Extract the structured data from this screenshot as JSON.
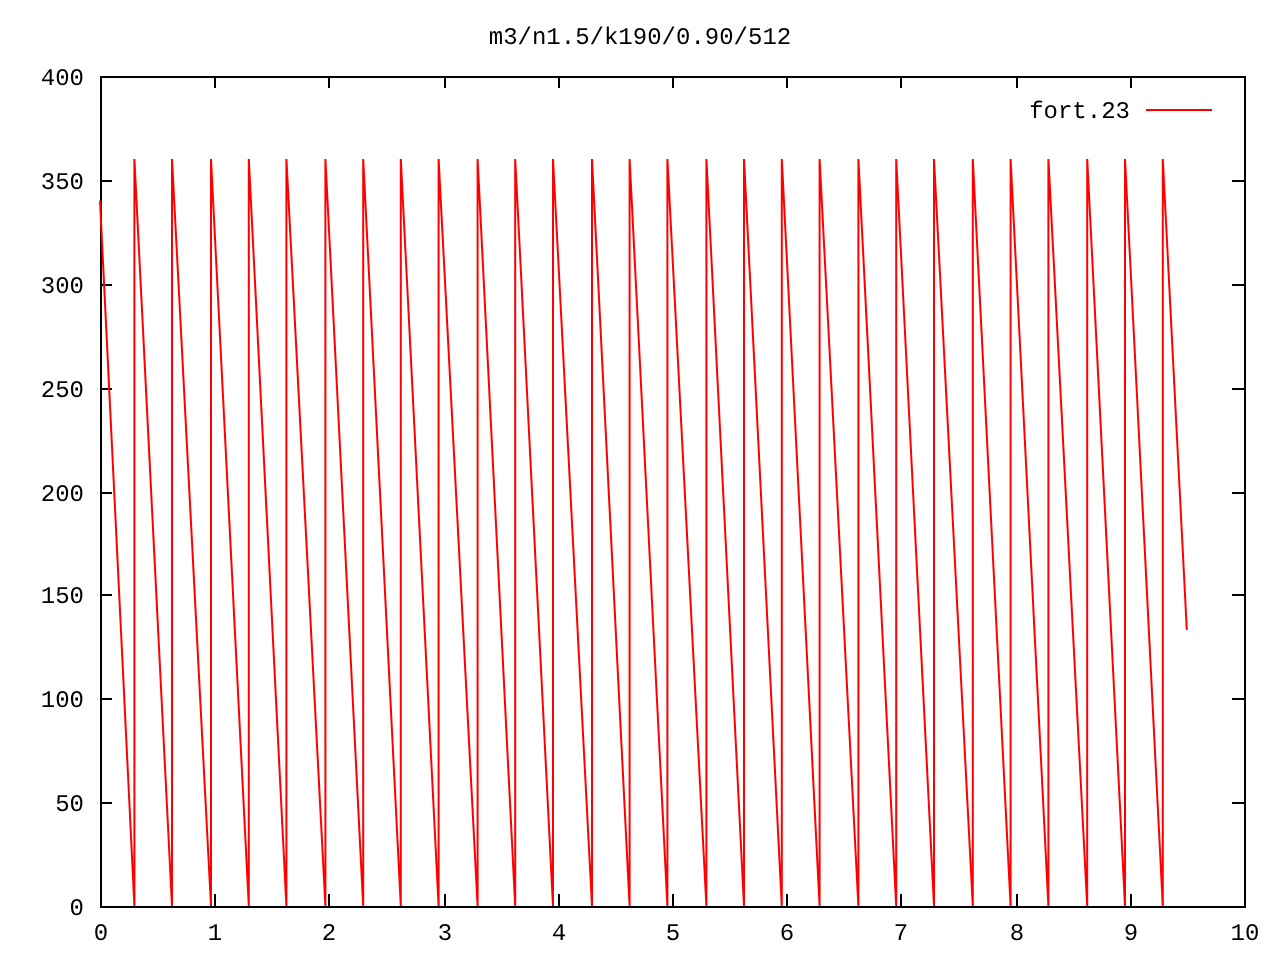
{
  "chart_data": {
    "type": "line",
    "title": "m3/n1.5/k190/0.90/512",
    "xlim": [
      0,
      10
    ],
    "ylim": [
      0,
      400
    ],
    "xticks": [
      0,
      1,
      2,
      3,
      4,
      5,
      6,
      7,
      8,
      9,
      10
    ],
    "yticks": [
      0,
      50,
      100,
      150,
      200,
      250,
      300,
      350,
      400
    ],
    "x": [
      0,
      0.3,
      0.3,
      0.63,
      0.63,
      0.97,
      0.97,
      1.3,
      1.3,
      1.63,
      1.63,
      1.97,
      1.97,
      2.3,
      2.3,
      2.63,
      2.63,
      2.96,
      2.96,
      3.3,
      3.3,
      3.63,
      3.63,
      3.96,
      3.96,
      4.3,
      4.3,
      4.63,
      4.63,
      4.96,
      4.96,
      5.3,
      5.3,
      5.63,
      5.63,
      5.96,
      5.96,
      6.29,
      6.29,
      6.63,
      6.63,
      6.96,
      6.96,
      7.29,
      7.29,
      7.63,
      7.63,
      7.96,
      7.96,
      8.29,
      8.29,
      8.63,
      8.63,
      8.96,
      8.96,
      9.29,
      9.29,
      9.5
    ],
    "series": [
      {
        "name": "fort.23",
        "color": "#ff0000",
        "values": [
          340,
          0,
          360,
          0,
          360,
          0,
          360,
          0,
          360,
          0,
          360,
          0,
          360,
          0,
          360,
          0,
          360,
          0,
          360,
          0,
          360,
          0,
          360,
          0,
          360,
          0,
          360,
          0,
          360,
          0,
          360,
          0,
          360,
          0,
          360,
          0,
          360,
          0,
          360,
          0,
          360,
          0,
          360,
          0,
          360,
          0,
          360,
          0,
          360,
          0,
          360,
          0,
          360,
          0,
          360,
          0,
          360,
          133
        ]
      }
    ]
  }
}
